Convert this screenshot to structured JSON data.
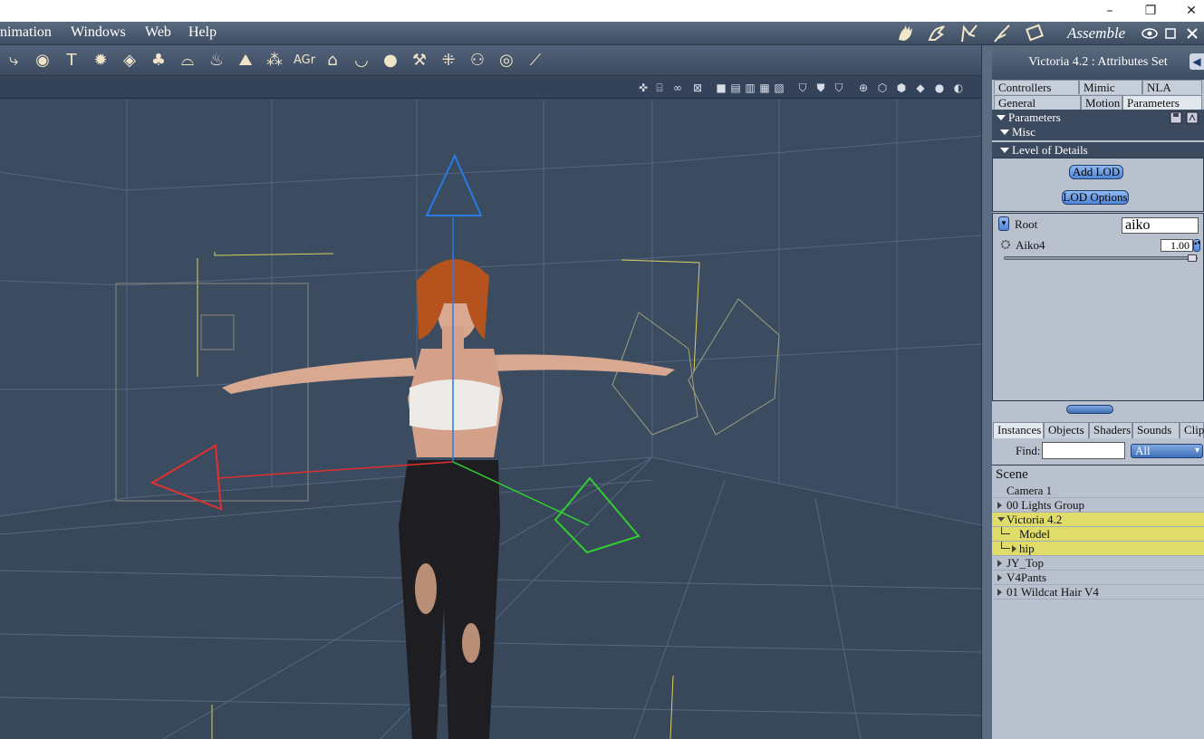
{
  "window": {
    "minimize": "–",
    "restore": "❐",
    "close": "✕"
  },
  "menu": {
    "items": [
      "nimation",
      "Windows",
      "Web",
      "Help"
    ],
    "room_label": "Assemble"
  },
  "panel": {
    "title": "Victoria 4.2 : Attributes Set",
    "tabs_row1": [
      "Controllers",
      "Mimic",
      "NLA"
    ],
    "tabs_row2": [
      "General",
      "Motion",
      "Parameters"
    ],
    "sections": {
      "parameters": "Parameters",
      "misc": "Misc",
      "lod": "Level of Details"
    },
    "buttons": {
      "add_lod": "Add LOD",
      "lod_options": "LOD Options"
    },
    "root_label": "Root",
    "root_value": "aiko",
    "morph_label": "Aiko4",
    "morph_value": "1.00",
    "slider_value": 1.0
  },
  "browser": {
    "tabs": [
      "Instances",
      "Objects",
      "Shaders",
      "Sounds",
      "Clips"
    ],
    "find_label": "Find:",
    "find_value": "",
    "filter_selected": "All",
    "scene_header": "Scene",
    "rows": [
      {
        "label": "Camera 1",
        "expander": "none",
        "selected": false
      },
      {
        "label": "00 Lights Group",
        "expander": "right",
        "selected": false
      },
      {
        "label": "Victoria 4.2",
        "expander": "down",
        "selected": true
      },
      {
        "label": "Model",
        "expander": "tree",
        "selected": true
      },
      {
        "label": "hip",
        "expander": "tree-right",
        "selected": true
      },
      {
        "label": "JY_Top",
        "expander": "right",
        "selected": false
      },
      {
        "label": "V4Pants",
        "expander": "right",
        "selected": false
      },
      {
        "label": "01 Wildcat Hair V4",
        "expander": "right",
        "selected": false
      }
    ]
  },
  "toolbar": {
    "agr_label": "AGr"
  },
  "colors": {
    "viewport_bg": "#3b4b60",
    "grid": "#5a6a80",
    "gizmo_x": "#e03030",
    "gizmo_y": "#2a7ae8",
    "gizmo_z": "#30d030",
    "selection_row": "#e0dc6a"
  }
}
